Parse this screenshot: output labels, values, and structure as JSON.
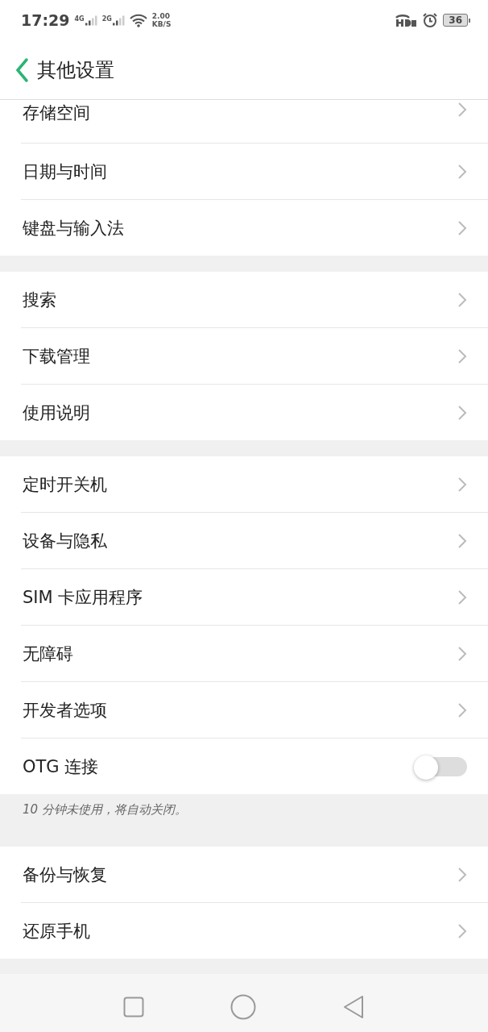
{
  "status_bar": {
    "time": "17:29",
    "signals": [
      {
        "label": "4G"
      },
      {
        "label": "2G"
      }
    ],
    "speed": {
      "value": "2.00",
      "unit": "KB/S"
    },
    "battery": "36"
  },
  "header": {
    "title": "其他设置"
  },
  "sections": [
    {
      "items": [
        {
          "label": "存储空间",
          "kind": "link"
        },
        {
          "label": "日期与时间",
          "kind": "link"
        },
        {
          "label": "键盘与输入法",
          "kind": "link"
        }
      ]
    },
    {
      "items": [
        {
          "label": "搜索",
          "kind": "link"
        },
        {
          "label": "下载管理",
          "kind": "link"
        },
        {
          "label": "使用说明",
          "kind": "link"
        }
      ]
    },
    {
      "items": [
        {
          "label": "定时开关机",
          "kind": "link"
        },
        {
          "label": "设备与隐私",
          "kind": "link"
        },
        {
          "label": "SIM 卡应用程序",
          "kind": "link"
        },
        {
          "label": "无障碍",
          "kind": "link"
        },
        {
          "label": "开发者选项",
          "kind": "link"
        },
        {
          "label": "OTG 连接",
          "kind": "toggle",
          "on": false
        }
      ],
      "note": "10 分钟未使用，将自动关闭。"
    },
    {
      "items": [
        {
          "label": "备份与恢复",
          "kind": "link"
        },
        {
          "label": "还原手机",
          "kind": "link"
        }
      ]
    }
  ]
}
